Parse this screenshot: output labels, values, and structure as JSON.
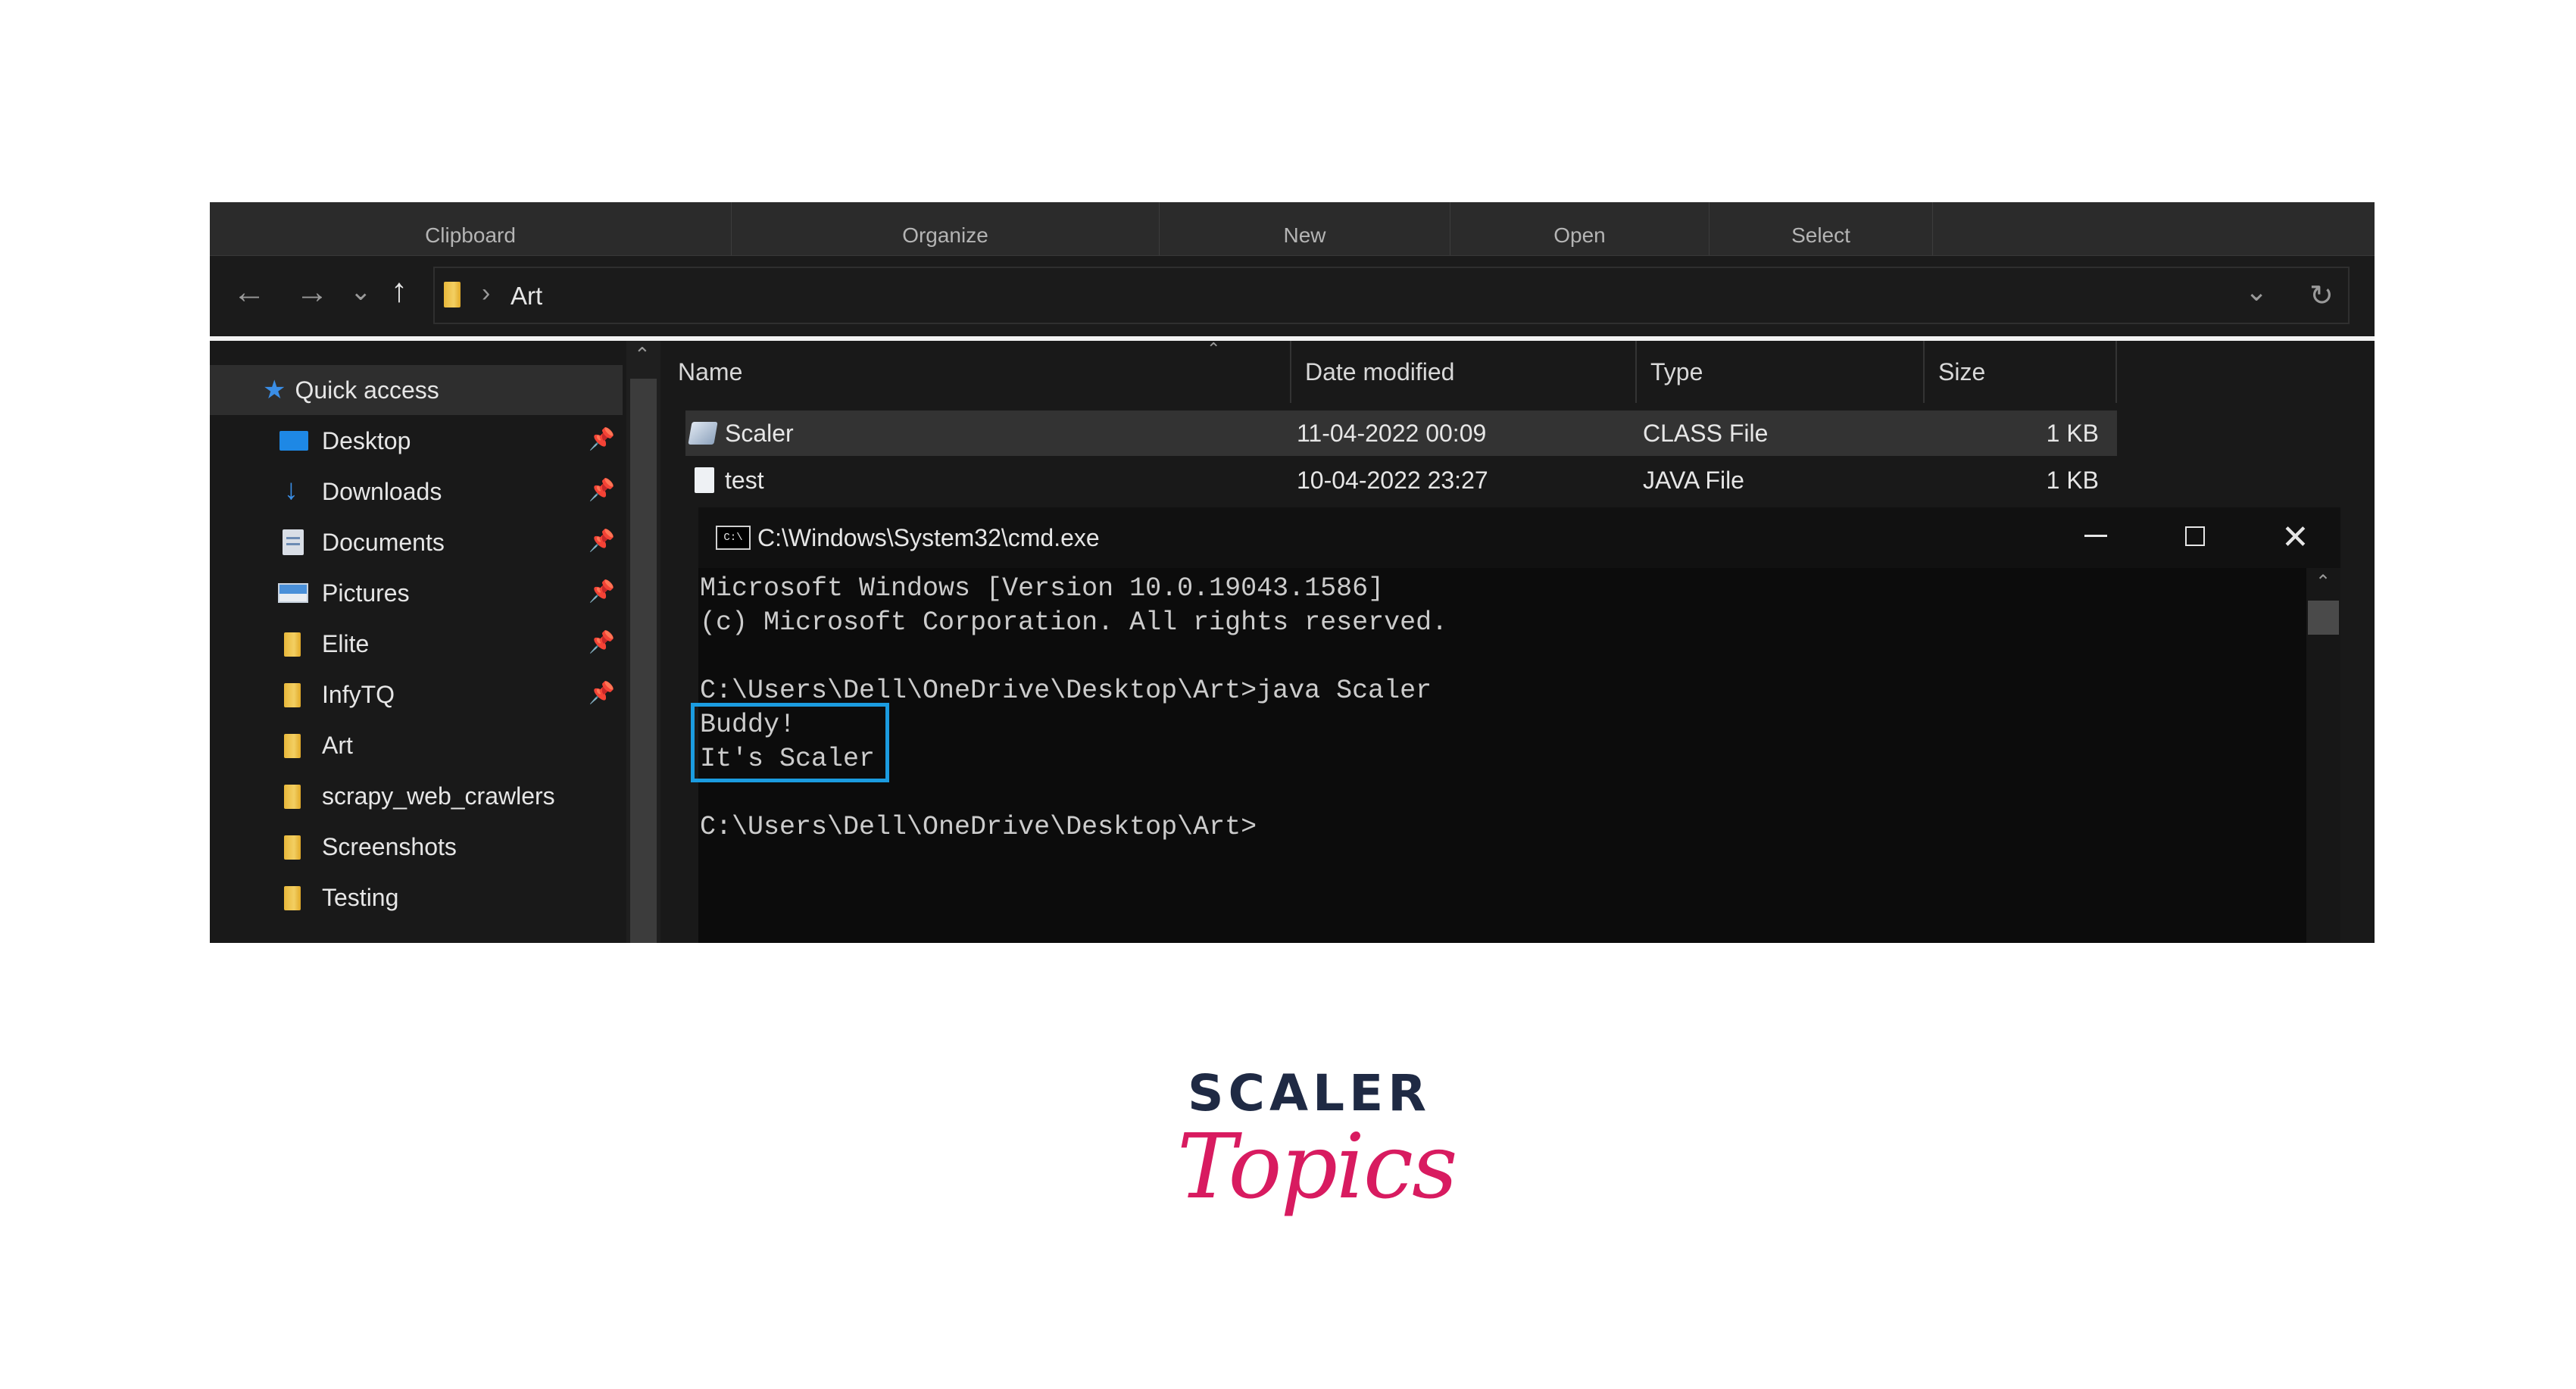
{
  "ribbon": {
    "groups": [
      "Clipboard",
      "Organize",
      "New",
      "Open",
      "Select"
    ]
  },
  "navigation": {
    "icons": [
      "back-arrow-icon",
      "forward-arrow-icon",
      "recent-chevron-icon",
      "up-arrow-icon"
    ],
    "address_path": "Art",
    "dropdown_icon": "chevron-down-icon",
    "refresh_icon": "refresh-icon"
  },
  "sidebar": {
    "items": [
      {
        "label": "Quick access",
        "icon": "star-icon",
        "pinned": false,
        "selected": true
      },
      {
        "label": "Desktop",
        "icon": "desktop-icon",
        "pinned": true
      },
      {
        "label": "Downloads",
        "icon": "download-icon",
        "pinned": true
      },
      {
        "label": "Documents",
        "icon": "documents-icon",
        "pinned": true
      },
      {
        "label": "Pictures",
        "icon": "pictures-icon",
        "pinned": true
      },
      {
        "label": "Elite",
        "icon": "folder-icon",
        "pinned": true
      },
      {
        "label": "InfyTQ",
        "icon": "folder-icon",
        "pinned": true
      },
      {
        "label": "Art",
        "icon": "folder-icon",
        "pinned": false
      },
      {
        "label": "scrapy_web_crawlers",
        "icon": "folder-icon",
        "pinned": false
      },
      {
        "label": "Screenshots",
        "icon": "folder-icon",
        "pinned": false
      },
      {
        "label": "Testing",
        "icon": "folder-icon",
        "pinned": false
      }
    ]
  },
  "file_list": {
    "columns": [
      "Name",
      "Date modified",
      "Type",
      "Size"
    ],
    "rows": [
      {
        "name": "Scaler",
        "date": "11-04-2022 00:09",
        "type": "CLASS File",
        "size": "1 KB",
        "icon": "class-file-icon",
        "selected": true
      },
      {
        "name": "test",
        "date": "10-04-2022 23:27",
        "type": "JAVA File",
        "size": "1 KB",
        "icon": "text-file-icon",
        "selected": false
      }
    ]
  },
  "cmd": {
    "title": "C:\\Windows\\System32\\cmd.exe",
    "lines": [
      "Microsoft Windows [Version 10.0.19043.1586]",
      "(c) Microsoft Corporation. All rights reserved.",
      "",
      "C:\\Users\\Dell\\OneDrive\\Desktop\\Art>java Scaler",
      "Buddy!",
      "It's Scaler",
      "",
      "C:\\Users\\Dell\\OneDrive\\Desktop\\Art>"
    ]
  },
  "logo": {
    "top": "SCALER",
    "script": "Topics",
    "colors": {
      "dark": "#1f2a44",
      "pink": "#d81b60"
    }
  },
  "colors": {
    "highlight": "#1b9ce0",
    "accent_blue": "#3a8ee6"
  }
}
